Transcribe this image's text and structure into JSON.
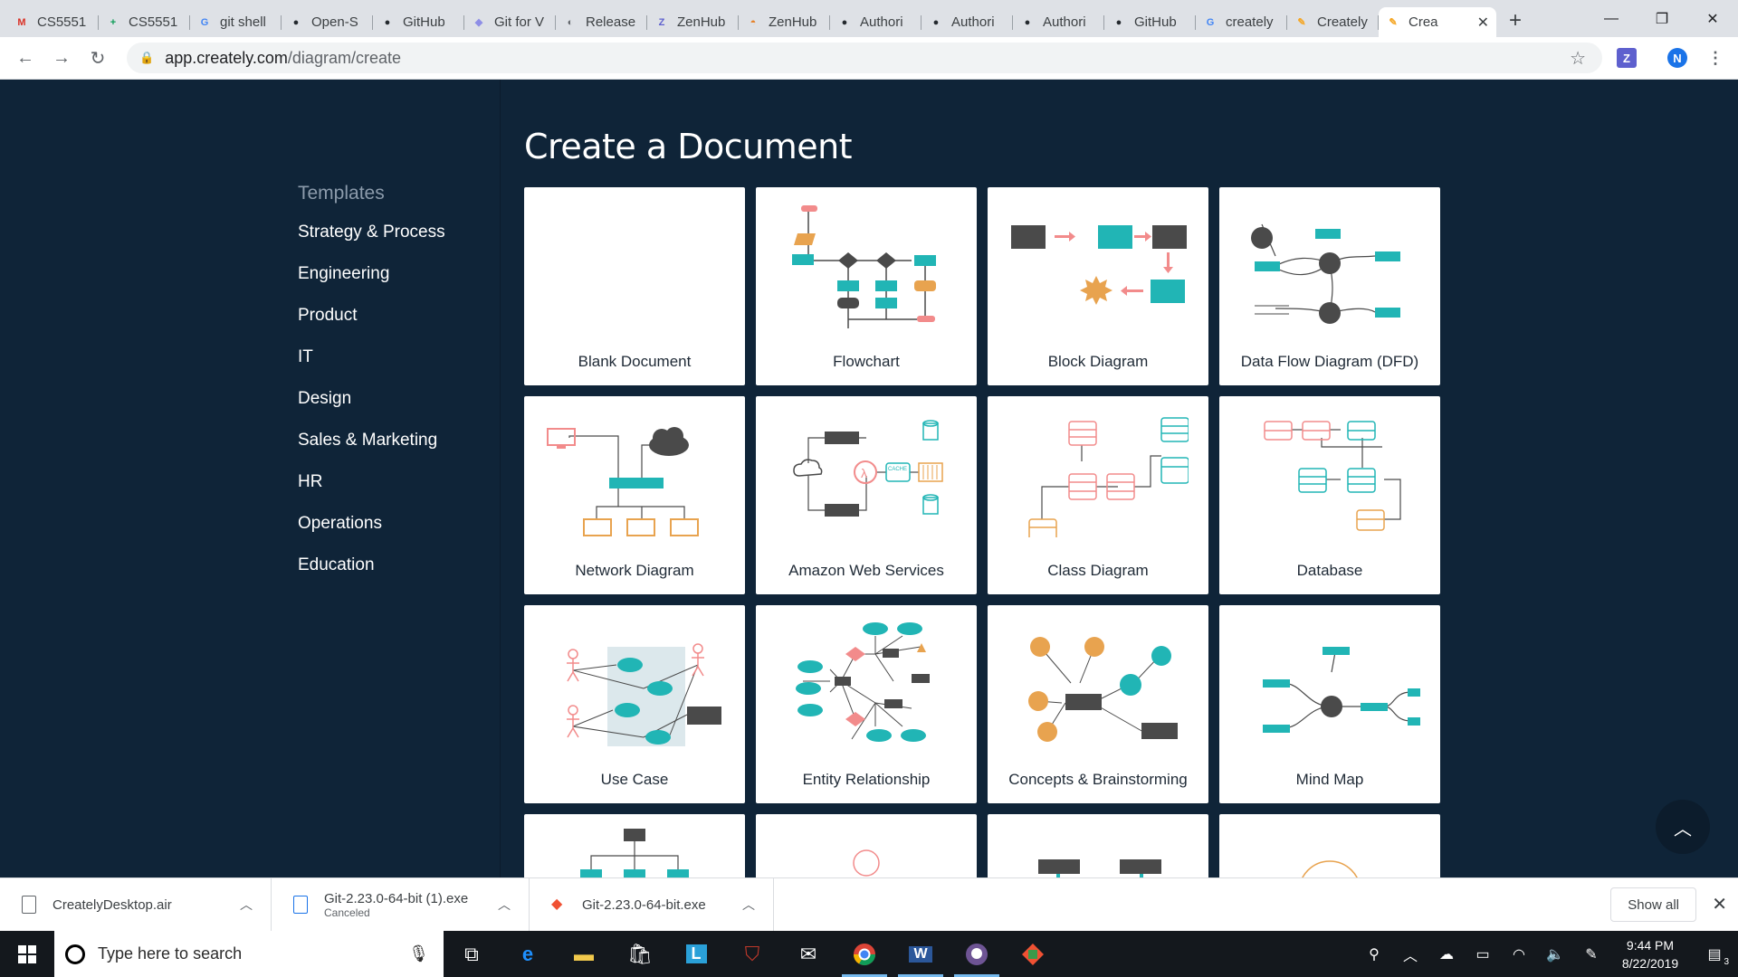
{
  "browser": {
    "tabs": [
      {
        "title": "CS5551",
        "icon": "gmail-icon",
        "color": "#d93025",
        "glyph": "M"
      },
      {
        "title": "CS5551",
        "icon": "sheets-icon",
        "color": "#0f9d58",
        "glyph": "+"
      },
      {
        "title": "git shell",
        "icon": "google-icon",
        "color": "#4285f4",
        "glyph": "G"
      },
      {
        "title": "Open-S",
        "icon": "github-icon",
        "color": "#24292e",
        "glyph": "●"
      },
      {
        "title": "GitHub",
        "icon": "github-icon",
        "color": "#24292e",
        "glyph": "●"
      },
      {
        "title": "Git for V",
        "icon": "git-icon",
        "color": "#8e8ee6",
        "glyph": "◆"
      },
      {
        "title": "Release",
        "icon": "globe-icon",
        "color": "#5f6368",
        "glyph": "◐"
      },
      {
        "title": "ZenHub",
        "icon": "zenhub-icon",
        "color": "#5e60ce",
        "glyph": "Z"
      },
      {
        "title": "ZenHub",
        "icon": "zenhub-logo-icon",
        "color": "#e67e22",
        "glyph": "◓"
      },
      {
        "title": "Authori",
        "icon": "github-icon",
        "color": "#24292e",
        "glyph": "●"
      },
      {
        "title": "Authori",
        "icon": "github-icon",
        "color": "#24292e",
        "glyph": "●"
      },
      {
        "title": "Authori",
        "icon": "github-icon",
        "color": "#24292e",
        "glyph": "●"
      },
      {
        "title": "GitHub",
        "icon": "github-icon",
        "color": "#24292e",
        "glyph": "●"
      },
      {
        "title": "creately",
        "icon": "google-icon",
        "color": "#4285f4",
        "glyph": "G"
      },
      {
        "title": "Creately",
        "icon": "creately-icon",
        "color": "#f5a623",
        "glyph": "✎"
      }
    ],
    "active_tab": {
      "title": "Crea",
      "icon": "creately-icon",
      "color": "#f5a623",
      "glyph": "✎"
    },
    "url_host": "app.creately.com",
    "url_path": "/diagram/create",
    "profile_initial": "N"
  },
  "page": {
    "title": "Create a Document",
    "sidebar": {
      "heading": "Templates",
      "items": [
        "Strategy & Process",
        "Engineering",
        "Product",
        "IT",
        "Design",
        "Sales & Marketing",
        "HR",
        "Operations",
        "Education"
      ]
    },
    "cards": [
      {
        "label": "Blank Document",
        "name": "card-blank-document"
      },
      {
        "label": "Flowchart",
        "name": "card-flowchart"
      },
      {
        "label": "Block Diagram",
        "name": "card-block-diagram"
      },
      {
        "label": "Data Flow Diagram (DFD)",
        "name": "card-data-flow-diagram"
      },
      {
        "label": "Network Diagram",
        "name": "card-network-diagram"
      },
      {
        "label": "Amazon Web Services",
        "name": "card-amazon-web-services"
      },
      {
        "label": "Class Diagram",
        "name": "card-class-diagram"
      },
      {
        "label": "Database",
        "name": "card-database"
      },
      {
        "label": "Use Case",
        "name": "card-use-case"
      },
      {
        "label": "Entity Relationship",
        "name": "card-entity-relationship"
      },
      {
        "label": "Concepts & Brainstorming",
        "name": "card-concepts-brainstorming"
      },
      {
        "label": "Mind Map",
        "name": "card-mind-map"
      }
    ],
    "aws_cache_label": "CACHE",
    "colors": {
      "teal": "#21b5b5",
      "dark": "#4a4a4a",
      "pink": "#f28b8b",
      "orange": "#e8a34f",
      "navy": "#0f2438"
    }
  },
  "downloads": {
    "items": [
      {
        "name": "CreatelyDesktop.air",
        "status": ""
      },
      {
        "name": "Git-2.23.0-64-bit (1).exe",
        "status": "Canceled"
      },
      {
        "name": "Git-2.23.0-64-bit.exe",
        "status": ""
      }
    ],
    "show_all": "Show all"
  },
  "taskbar": {
    "search_placeholder": "Type here to search",
    "time": "9:44 PM",
    "date": "8/22/2019",
    "notification_count": "3"
  }
}
